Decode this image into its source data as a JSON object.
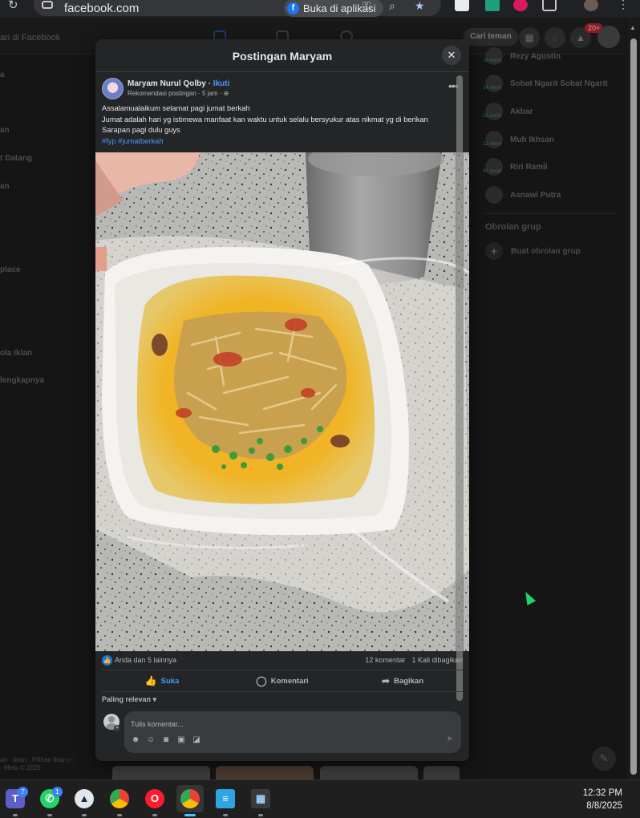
{
  "browser": {
    "url": "facebook.com",
    "open_in_app_label": "Buka di aplikasi"
  },
  "facebook": {
    "search_placeholder": "ari di Facebook",
    "find_friends_label": "Cari teman",
    "notification_count": "20+",
    "left_menu": [
      "a",
      "an",
      "t Datang",
      "an",
      "place",
      "ola Iklan",
      "lengkapnya"
    ],
    "left_footer": [
      "an · Iklan · Pilihan Iklan ▷",
      "· Meta © 2025"
    ],
    "contacts": [
      {
        "name": "Rezy Agustin",
        "status": "16 menit"
      },
      {
        "name": "Sobat Ngarit Sobat Ngarit",
        "status": "14 menit"
      },
      {
        "name": "Akbar",
        "status": "15 menit"
      },
      {
        "name": "Muh Ikhsan",
        "status": "12 menit"
      },
      {
        "name": "Riri Ramli",
        "status": "42 menit"
      },
      {
        "name": "Asnawi Putra",
        "status": ""
      }
    ],
    "group_chats_title": "Obrolan grup",
    "create_group_label": "Buat obrolan grup"
  },
  "modal": {
    "title": "Postingan Maryam",
    "author": "Maryam Nurul Qolby",
    "separator": " · ",
    "follow_label": "Ikuti",
    "meta": "Rekomendasi postingan · 5 jam · ",
    "text_lines": [
      "Assalamualaikum selamat pagi jumat berkah",
      "Jumat adalah hari yg istimewa manfaat kan waktu untuk selalu bersyukur atas nikmat yg di berikan",
      "Sarapan pagi dulu guys"
    ],
    "hashtags": "#fyp #jumatberkah",
    "reactions": "Anda dan 5 lainnya",
    "comments_count": "12 komentar",
    "shares_count": "1 Kali dibagikan",
    "actions": {
      "like": "Suka",
      "comment": "Komentari",
      "share": "Bagikan"
    },
    "sort_label": "Paling relevan",
    "comment_placeholder": "Tulis komentar..."
  },
  "taskbar": {
    "teams_badge": "7",
    "whatsapp_badge": "1",
    "time": "12:32 PM",
    "date": "8/8/2025"
  },
  "colors": {
    "link_blue": "#4599ff",
    "modal_bg": "#242526",
    "like_blue": "#1b74e4"
  }
}
